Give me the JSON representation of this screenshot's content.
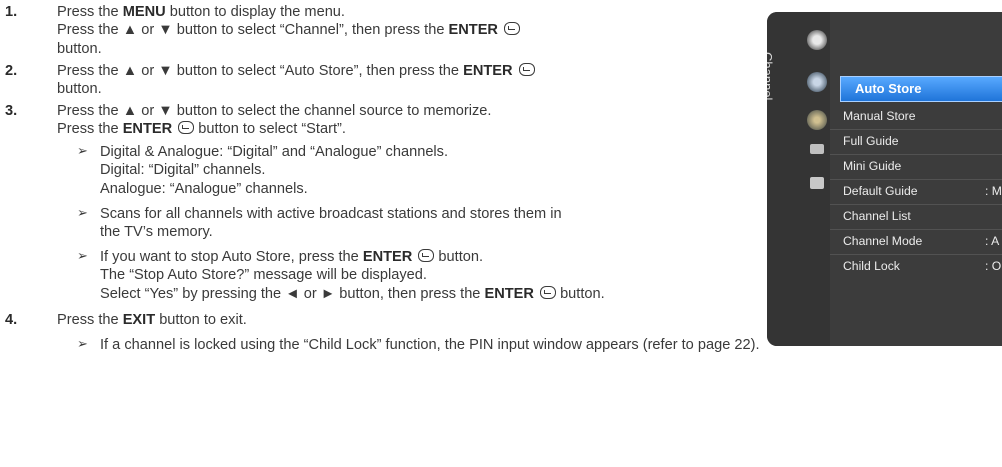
{
  "steps": {
    "s1": {
      "num": "1.",
      "l1a": "Press the ",
      "l1b": "MENU",
      "l1c": " button to display the menu.",
      "l2a": "Press the ▲ or ▼ button to select “Channel”, then press the ",
      "l2b": "ENTER",
      "l3": "button."
    },
    "s2": {
      "num": "2.",
      "l1a": "Press the ▲ or ▼ button to select “Auto Store”, then press the ",
      "l1b": "ENTER",
      "l2": "button."
    },
    "s3": {
      "num": "3.",
      "l1": "Press the ▲ or ▼ button to select the channel source to memorize.",
      "l2a": "Press the ",
      "l2b": "ENTER",
      "l2c": " button to select “Start”."
    },
    "s4": {
      "num": "4.",
      "l1a": "Press the ",
      "l1b": "EXIT",
      "l1c": " button to exit."
    }
  },
  "notes": {
    "arrow": "➢",
    "n1": {
      "l1": "Digital & Analogue: “Digital” and “Analogue” channels.",
      "l2": "Digital: “Digital” channels.",
      "l3": "Analogue: “Analogue” channels."
    },
    "n2": {
      "l1": "Scans for all channels with active broadcast stations and stores them in",
      "l2": "the TV’s memory."
    },
    "n3": {
      "l1a": "If you want to stop Auto Store, press the ",
      "l1b": "ENTER",
      "l1c": " button.",
      "l2": "The “Stop Auto Store?” message will be displayed.",
      "l3a": "Select “Yes” by pressing the ◄ or ► button, then press the ",
      "l3b": "ENTER",
      "l3c": " button."
    },
    "n4": {
      "l1": "If a channel is locked using the “Child Lock” function, the PIN input window appears (refer to page 22)."
    }
  },
  "tv_menu": {
    "side_label": "Channel",
    "selected": "Auto Store",
    "items": [
      {
        "label": "Manual Store",
        "value": ""
      },
      {
        "label": "Full Guide",
        "value": ""
      },
      {
        "label": "Mini Guide",
        "value": ""
      },
      {
        "label": "Default Guide",
        "value": ": M"
      },
      {
        "label": "Channel List",
        "value": ""
      },
      {
        "label": "Channel Mode",
        "value": ": A"
      },
      {
        "label": "Child Lock",
        "value": ": O"
      }
    ],
    "colors": {
      "highlight": "#3a8ef0",
      "panel": "#3c3c3c"
    }
  }
}
